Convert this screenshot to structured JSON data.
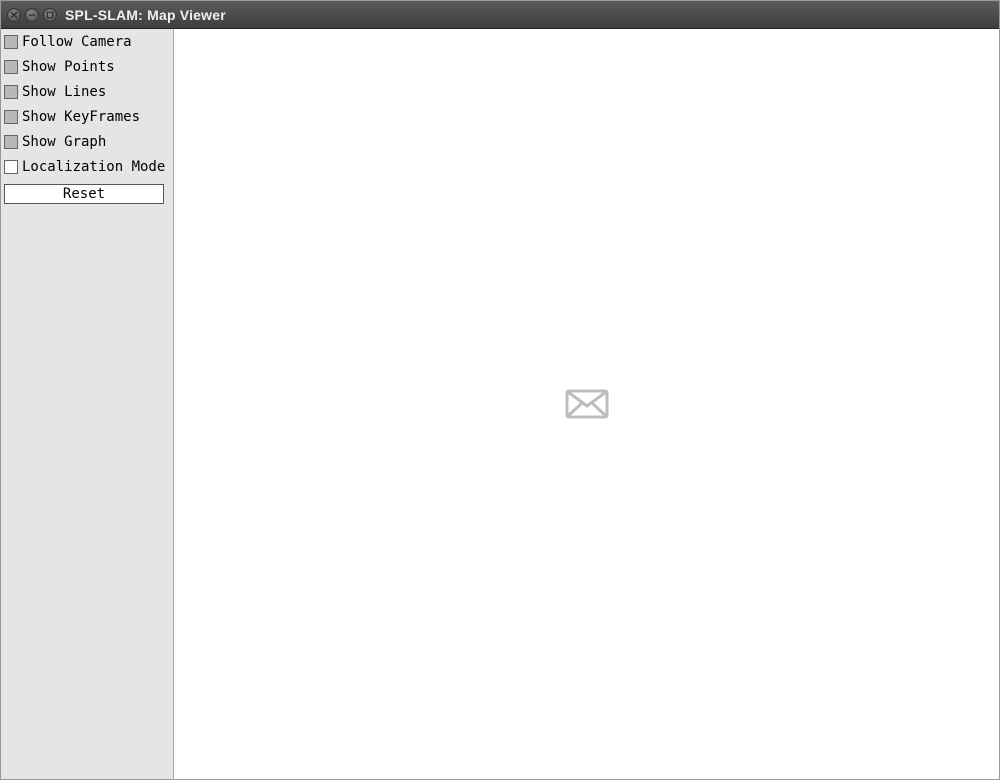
{
  "window": {
    "title": "SPL-SLAM: Map Viewer"
  },
  "sidebar": {
    "items": [
      {
        "label": "Follow Camera",
        "checked": true
      },
      {
        "label": "Show Points",
        "checked": true
      },
      {
        "label": "Show Lines",
        "checked": true
      },
      {
        "label": "Show KeyFrames",
        "checked": true
      },
      {
        "label": "Show Graph",
        "checked": true
      },
      {
        "label": "Localization Mode",
        "checked": false
      }
    ],
    "reset_label": "Reset"
  },
  "viewport": {
    "placeholder_icon": "envelope-icon"
  }
}
